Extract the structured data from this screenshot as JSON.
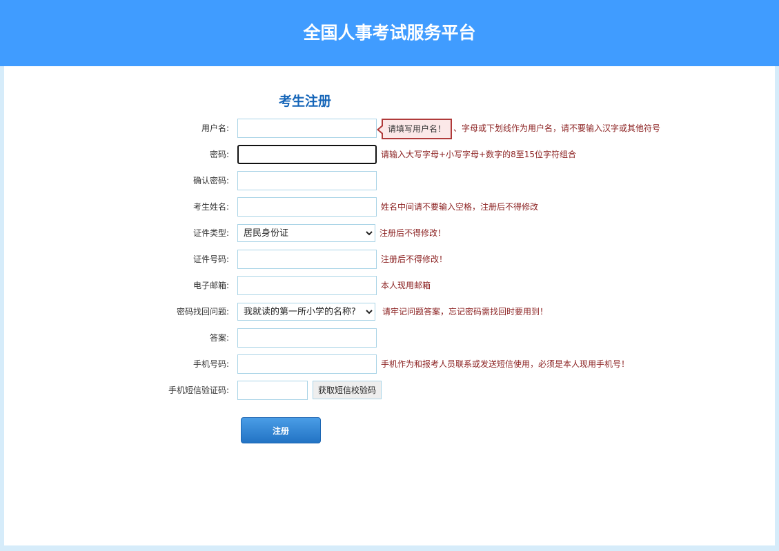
{
  "header": {
    "title": "全国人事考试服务平台"
  },
  "form": {
    "title": "考生注册",
    "fields": {
      "username": {
        "label": "用户名:",
        "value": "",
        "hint": "、字母或下划线作为用户名，请不要输入汉字或其他符号",
        "tooltip": "请填写用户名！"
      },
      "password": {
        "label": "密码:",
        "value": "",
        "hint": "请输入大写字母+小写字母+数字的8至15位字符组合"
      },
      "confirm_password": {
        "label": "确认密码:",
        "value": ""
      },
      "name": {
        "label": "考生姓名:",
        "value": "",
        "hint": "姓名中间请不要输入空格，注册后不得修改"
      },
      "id_type": {
        "label": "证件类型:",
        "selected": "居民身份证",
        "hint": "注册后不得修改！"
      },
      "id_number": {
        "label": "证件号码:",
        "value": "",
        "hint": "注册后不得修改！"
      },
      "email": {
        "label": "电子邮箱:",
        "value": "",
        "hint": "本人现用邮箱"
      },
      "security_question": {
        "label": "密码找回问题:",
        "selected": "我就读的第一所小学的名称?",
        "hint": "请牢记问题答案，忘记密码需找回时要用到！"
      },
      "answer": {
        "label": "答案:",
        "value": ""
      },
      "phone": {
        "label": "手机号码:",
        "value": "",
        "hint": "手机作为和报考人员联系或发送短信使用，必须是本人现用手机号！"
      },
      "sms_code": {
        "label": "手机短信验证码:",
        "value": "",
        "button_label": "获取短信校验码"
      }
    },
    "submit_label": "注册"
  },
  "colors": {
    "header_bg": "#409cff",
    "page_bg": "#d6ecfa",
    "title_color": "#1565b8",
    "hint_color": "#8a1f1f",
    "input_border": "#a8d3e6",
    "submit_bg": "#2a7fd0"
  }
}
